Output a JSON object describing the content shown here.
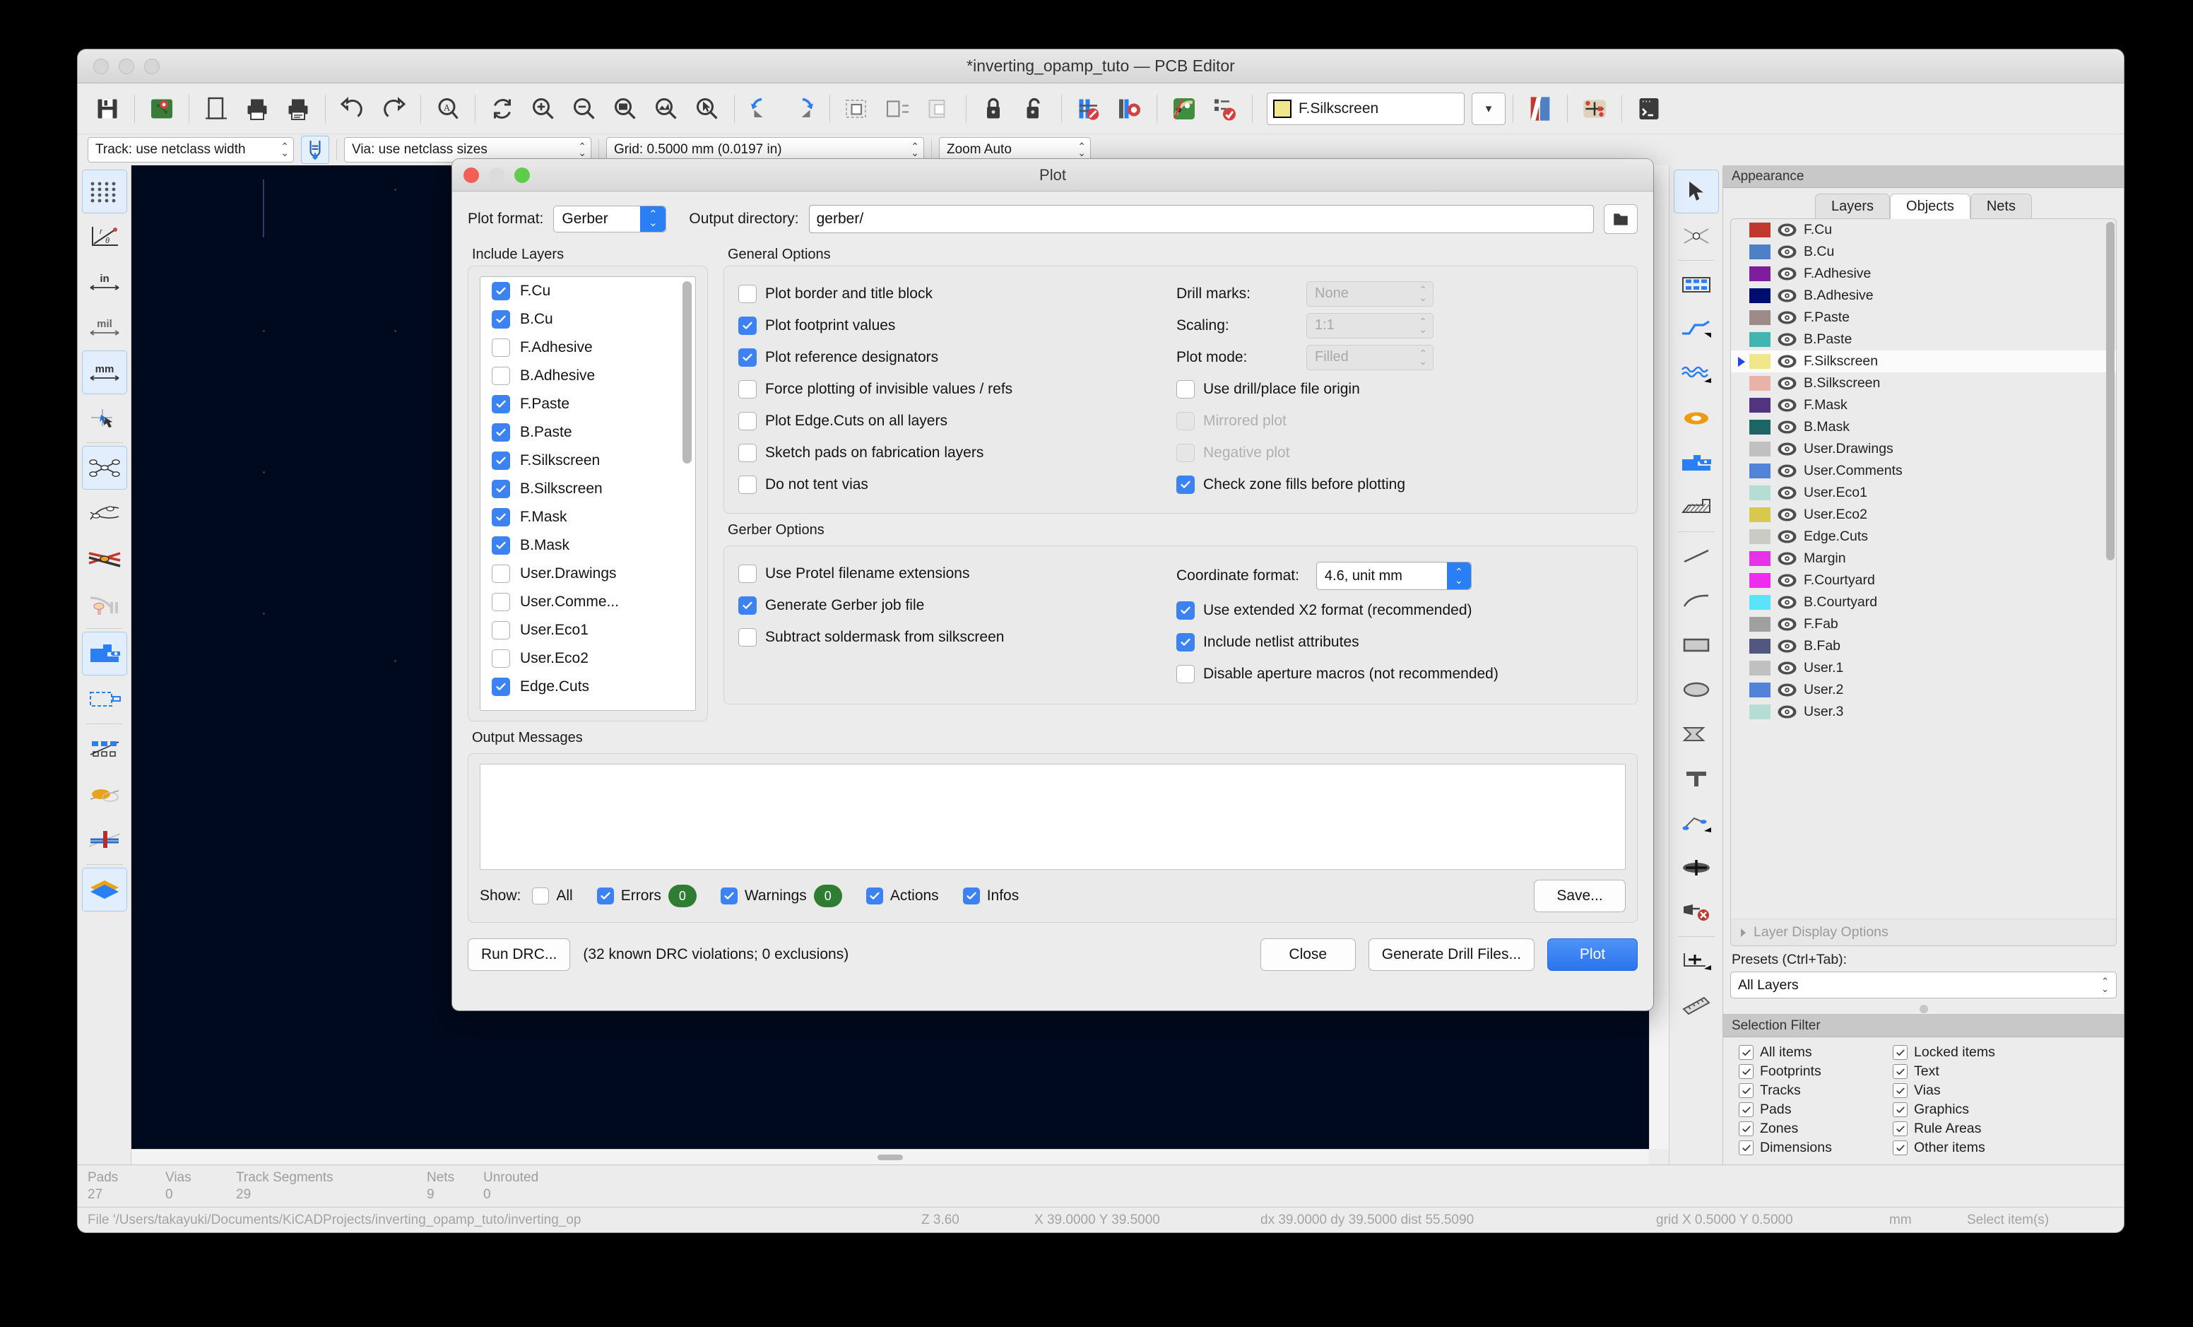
{
  "window": {
    "title": "*inverting_opamp_tuto — PCB Editor"
  },
  "toolbar": {
    "active_layer": "F.Silkscreen",
    "layer_swatch_color": "#f0e68c",
    "icons": [
      "save-icon",
      "board-setup-icon",
      "page-settings-icon",
      "print-icon",
      "plot-icon",
      "undo-icon",
      "redo-icon",
      "find-icon",
      "refresh-icon",
      "zoom-in-icon",
      "zoom-out-icon",
      "zoom-fit-icon",
      "zoom-objects-icon",
      "zoom-selection-icon",
      "flip-left-icon",
      "flip-right-icon",
      "group-icon",
      "ungroup-icon",
      "lock-icon",
      "unlock-icon",
      "drc-icon",
      "footprint-check-icon",
      "net-inspector-icon",
      "checklist-icon",
      "layer-pair-icon",
      "ratsnest-icon",
      "scripting-icon"
    ]
  },
  "toolbar2": {
    "track_width": "Track: use netclass width",
    "via_size": "Via: use netclass sizes",
    "grid": "Grid: 0.5000 mm (0.0197 in)",
    "zoom": "Zoom Auto"
  },
  "left_toolbar": {
    "items": [
      {
        "name": "toggle-grid-icon",
        "active": true
      },
      {
        "name": "polar-coords-icon",
        "active": false
      },
      {
        "name": "units-inches-icon",
        "active": false
      },
      {
        "name": "units-mils-icon",
        "active": false
      },
      {
        "name": "units-mm-icon",
        "active": true
      },
      {
        "name": "cursor-fullscreen-icon",
        "active": false
      },
      {
        "name": "ratsnest-show-icon",
        "active": true
      },
      {
        "name": "ratsnest-curved-icon",
        "active": false
      },
      {
        "name": "net-color-icon",
        "active": false
      },
      {
        "name": "ratsnest-layer-icon",
        "active": false
      },
      {
        "name": "zone-filled-icon",
        "active": true
      },
      {
        "name": "zone-outline-icon",
        "active": false
      },
      {
        "name": "pad-sketch-icon",
        "active": false
      },
      {
        "name": "via-sketch-icon",
        "active": false
      },
      {
        "name": "track-sketch-icon",
        "active": false
      },
      {
        "name": "layers-contrast-icon",
        "active": true
      }
    ]
  },
  "right_toolbar": {
    "items": [
      {
        "name": "select-tool-icon",
        "active": true
      },
      {
        "name": "highlight-net-icon",
        "active": false
      },
      {
        "name": "place-footprint-icon",
        "active": false
      },
      {
        "name": "route-track-icon",
        "active": false
      },
      {
        "name": "route-diffpair-icon",
        "active": false
      },
      {
        "name": "place-via-icon",
        "active": false
      },
      {
        "name": "draw-zone-icon",
        "active": false
      },
      {
        "name": "draw-rule-area-icon",
        "active": false
      },
      {
        "name": "draw-line-icon",
        "active": false
      },
      {
        "name": "draw-arc-icon",
        "active": false
      },
      {
        "name": "draw-rectangle-icon",
        "active": false
      },
      {
        "name": "draw-circle-icon",
        "active": false
      },
      {
        "name": "draw-polygon-icon",
        "active": false
      },
      {
        "name": "add-text-icon",
        "active": false
      },
      {
        "name": "add-dimension-icon",
        "active": false
      },
      {
        "name": "add-drill-origin-icon",
        "active": false
      },
      {
        "name": "delete-tool-icon",
        "active": false
      },
      {
        "name": "set-origin-icon",
        "active": false
      },
      {
        "name": "measure-tool-icon",
        "active": false
      }
    ]
  },
  "appearance": {
    "panel_title": "Appearance",
    "tabs": [
      {
        "label": "Layers",
        "active": false
      },
      {
        "label": "Objects",
        "active": true
      },
      {
        "label": "Nets",
        "active": false
      }
    ],
    "layers": [
      {
        "name": "F.Cu",
        "color": "#c0392f",
        "selected": false
      },
      {
        "name": "B.Cu",
        "color": "#4f7fc4",
        "selected": false
      },
      {
        "name": "F.Adhesive",
        "color": "#7e1e9c",
        "selected": false
      },
      {
        "name": "B.Adhesive",
        "color": "#000d70",
        "selected": false
      },
      {
        "name": "F.Paste",
        "color": "#9d8a89",
        "selected": false
      },
      {
        "name": "B.Paste",
        "color": "#42b5b2",
        "selected": false
      },
      {
        "name": "F.Silkscreen",
        "color": "#f0e68c",
        "selected": true
      },
      {
        "name": "B.Silkscreen",
        "color": "#e8b2a8",
        "selected": false
      },
      {
        "name": "F.Mask",
        "color": "#51337f",
        "selected": false
      },
      {
        "name": "B.Mask",
        "color": "#1d6464",
        "selected": false
      },
      {
        "name": "User.Drawings",
        "color": "#c0c0c0",
        "selected": false
      },
      {
        "name": "User.Comments",
        "color": "#5283d8",
        "selected": false
      },
      {
        "name": "User.Eco1",
        "color": "#b5ddd4",
        "selected": false
      },
      {
        "name": "User.Eco2",
        "color": "#d6c94d",
        "selected": false
      },
      {
        "name": "Edge.Cuts",
        "color": "#cbcbc6",
        "selected": false
      },
      {
        "name": "Margin",
        "color": "#e832e8",
        "selected": false
      },
      {
        "name": "F.Courtyard",
        "color": "#ef2bef",
        "selected": false
      },
      {
        "name": "B.Courtyard",
        "color": "#5ae4fb",
        "selected": false
      },
      {
        "name": "F.Fab",
        "color": "#a0a0a0",
        "selected": false
      },
      {
        "name": "B.Fab",
        "color": "#51577e",
        "selected": false
      },
      {
        "name": "User.1",
        "color": "#c0c0c0",
        "selected": false
      },
      {
        "name": "User.2",
        "color": "#5283d8",
        "selected": false
      },
      {
        "name": "User.3",
        "color": "#b5ddd4",
        "selected": false
      }
    ],
    "layer_display_options": "Layer Display Options",
    "presets_label": "Presets (Ctrl+Tab):",
    "presets_value": "All Layers"
  },
  "selection_filter": {
    "title": "Selection Filter",
    "left": [
      {
        "label": "All items",
        "checked": true
      },
      {
        "label": "Footprints",
        "checked": true
      },
      {
        "label": "Tracks",
        "checked": true
      },
      {
        "label": "Pads",
        "checked": true
      },
      {
        "label": "Zones",
        "checked": true
      },
      {
        "label": "Dimensions",
        "checked": true
      }
    ],
    "right": [
      {
        "label": "Locked items",
        "checked": true
      },
      {
        "label": "Text",
        "checked": true
      },
      {
        "label": "Vias",
        "checked": true
      },
      {
        "label": "Graphics",
        "checked": true
      },
      {
        "label": "Rule Areas",
        "checked": true
      },
      {
        "label": "Other items",
        "checked": true
      }
    ]
  },
  "status": {
    "counts": [
      {
        "label": "Pads",
        "value": "27"
      },
      {
        "label": "Vias",
        "value": "0"
      },
      {
        "label": "Track Segments",
        "value": "29"
      },
      {
        "label": "Nets",
        "value": "9"
      },
      {
        "label": "Unrouted",
        "value": "0"
      }
    ],
    "file_path": "File '/Users/takayuki/Documents/KiCADProjects/inverting_opamp_tuto/inverting_op",
    "z_value": "Z 3.60",
    "coords": "X 39.0000  Y 39.5000",
    "delta": "dx 39.0000  dy 39.5000  dist 55.5090",
    "grid": "grid X 0.5000  Y 0.5000",
    "units": "mm",
    "mode": "Select item(s)"
  },
  "plot_dialog": {
    "title": "Plot",
    "plot_format_label": "Plot format:",
    "plot_format_value": "Gerber",
    "output_dir_label": "Output directory:",
    "output_dir_value": "gerber/",
    "include_layers_title": "Include Layers",
    "include_layers": [
      {
        "label": "F.Cu",
        "checked": true
      },
      {
        "label": "B.Cu",
        "checked": true
      },
      {
        "label": "F.Adhesive",
        "checked": false
      },
      {
        "label": "B.Adhesive",
        "checked": false
      },
      {
        "label": "F.Paste",
        "checked": true
      },
      {
        "label": "B.Paste",
        "checked": true
      },
      {
        "label": "F.Silkscreen",
        "checked": true
      },
      {
        "label": "B.Silkscreen",
        "checked": true
      },
      {
        "label": "F.Mask",
        "checked": true
      },
      {
        "label": "B.Mask",
        "checked": true
      },
      {
        "label": "User.Drawings",
        "checked": false
      },
      {
        "label": "User.Comme...",
        "checked": false
      },
      {
        "label": "User.Eco1",
        "checked": false
      },
      {
        "label": "User.Eco2",
        "checked": false
      },
      {
        "label": "Edge.Cuts",
        "checked": true
      }
    ],
    "general_options_title": "General Options",
    "general_left": [
      {
        "label": "Plot border and title block",
        "checked": false,
        "disabled": false
      },
      {
        "label": "Plot footprint values",
        "checked": true,
        "disabled": false
      },
      {
        "label": "Plot reference designators",
        "checked": true,
        "disabled": false
      },
      {
        "label": "Force plotting of invisible values / refs",
        "checked": false,
        "disabled": false
      },
      {
        "label": "Plot Edge.Cuts on all layers",
        "checked": false,
        "disabled": false
      },
      {
        "label": "Sketch pads on fabrication layers",
        "checked": false,
        "disabled": false
      },
      {
        "label": "Do not tent vias",
        "checked": false,
        "disabled": false
      }
    ],
    "general_right_fields": [
      {
        "label": "Drill marks:",
        "value": "None",
        "disabled": true
      },
      {
        "label": "Scaling:",
        "value": "1:1",
        "disabled": true
      },
      {
        "label": "Plot mode:",
        "value": "Filled",
        "disabled": true
      }
    ],
    "general_right_checks": [
      {
        "label": "Use drill/place file origin",
        "checked": false,
        "disabled": false
      },
      {
        "label": "Mirrored plot",
        "checked": false,
        "disabled": true
      },
      {
        "label": "Negative plot",
        "checked": false,
        "disabled": true
      },
      {
        "label": "Check zone fills before plotting",
        "checked": true,
        "disabled": false
      }
    ],
    "gerber_options_title": "Gerber Options",
    "gerber_left": [
      {
        "label": "Use Protel filename extensions",
        "checked": false
      },
      {
        "label": "Generate Gerber job file",
        "checked": true
      },
      {
        "label": "Subtract soldermask from silkscreen",
        "checked": false
      }
    ],
    "coord_format_label": "Coordinate format:",
    "coord_format_value": "4.6, unit mm",
    "gerber_right": [
      {
        "label": "Use extended X2 format (recommended)",
        "checked": true
      },
      {
        "label": "Include netlist attributes",
        "checked": true
      },
      {
        "label": "Disable aperture macros (not recommended)",
        "checked": false
      }
    ],
    "output_messages_title": "Output Messages",
    "show_label": "Show:",
    "show_items": [
      {
        "label": "All",
        "checked": false,
        "badge": null
      },
      {
        "label": "Errors",
        "checked": true,
        "badge": "0"
      },
      {
        "label": "Warnings",
        "checked": true,
        "badge": "0"
      },
      {
        "label": "Actions",
        "checked": true,
        "badge": null
      },
      {
        "label": "Infos",
        "checked": true,
        "badge": null
      }
    ],
    "save_button": "Save...",
    "run_drc_button": "Run DRC...",
    "drc_note": "(32 known DRC violations; 0 exclusions)",
    "close_button": "Close",
    "generate_drill_button": "Generate Drill Files...",
    "plot_button": "Plot"
  }
}
